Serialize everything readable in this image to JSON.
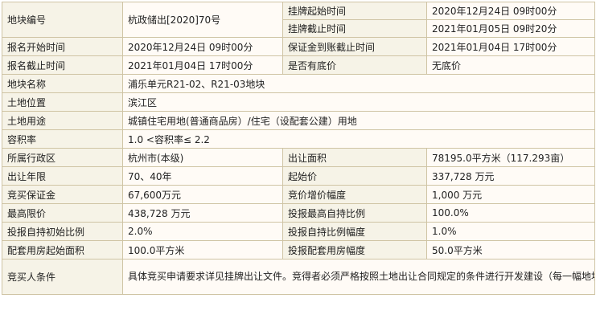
{
  "rows": {
    "r1": {
      "label": "地块编号",
      "value": "杭政储出[2020]70号",
      "sub": [
        {
          "label": "挂牌起始时间",
          "value": "2020年12月24日 09时00分"
        },
        {
          "label": "挂牌截止时间",
          "value": "2021年01月05日 09时20分"
        }
      ]
    },
    "r2": {
      "label": "报名开始时间",
      "value": "2020年12月24日 09时00分",
      "label2": "保证金到账截止时间",
      "value2": "2021年01月04日 17时00分"
    },
    "r3": {
      "label": "报名截止时间",
      "value": "2021年01月04日 17时00分",
      "label2": "是否有底价",
      "value2": "无底价"
    },
    "r4": {
      "label": "地块名称",
      "value": "浦乐单元R21-02、R21-03地块"
    },
    "r5": {
      "label": "土地位置",
      "value": "滨江区"
    },
    "r6": {
      "label": "土地用途",
      "value": "城镇住宅用地(普通商品房）/住宅（设配套公建）用地"
    },
    "r7": {
      "label": "容积率",
      "value": "1.0 <容积率≤ 2.2"
    },
    "r8": {
      "label": "所属行政区",
      "value": "杭州市(本级)",
      "label2": "出让面积",
      "value2": "78195.0平方米（117.293亩）"
    },
    "r9": {
      "label": "出让年限",
      "value": "70、40年",
      "label2": "起始价",
      "value2": "337,728 万元"
    },
    "r10": {
      "label": "竞买保证金",
      "value": "67,600万元",
      "label2": "竞价增价幅度",
      "value2": "1,000 万元"
    },
    "r11": {
      "label": "最高限价",
      "value": "438,728 万元",
      "label2": "投报最高自持比例",
      "value2": "100.0%"
    },
    "r12": {
      "label": "投报自持初始比例",
      "value": "2.0%",
      "label2": "投报自持比例幅度",
      "value2": "1.0%"
    },
    "r13": {
      "label": "配套用房起始面积",
      "value": "100.0平方米",
      "label2": "投报配套用房幅度",
      "value2": "50.0平方米"
    },
    "r14": {
      "label": "竞买人条件",
      "value": "具体竞买申请要求详见挂牌出让文件。竞得者必须严格按照土地出让合同规定的条件进行开发建设（每一幅地块参加竞价的条件和规划条件详见各宗地挂牌文件）。"
    }
  },
  "colors": {
    "border": "#cfc4a4",
    "label_bg": "#f6f3e7",
    "value_bg": "#fffbf6"
  }
}
